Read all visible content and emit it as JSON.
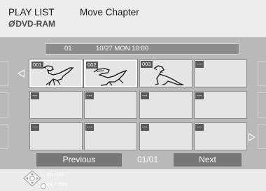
{
  "header": {
    "title": "PLAY LIST",
    "media": "DVD-RAM",
    "mode": "Move Chapter"
  },
  "info_bar": {
    "number": "01",
    "datetime": "10/27 MON 10:00"
  },
  "thumbnails": [
    {
      "label": "001",
      "content": "dinosaur-sketch-1",
      "selected": true
    },
    {
      "label": "002",
      "content": "dinosaur-sketch-2",
      "selected": true
    },
    {
      "label": "003",
      "content": "dinosaur-sketch-3",
      "selected": false
    },
    {
      "label": "---",
      "content": "empty",
      "selected": false
    },
    {
      "label": "---",
      "content": "empty",
      "selected": false
    },
    {
      "label": "---",
      "content": "empty",
      "selected": false
    },
    {
      "label": "---",
      "content": "empty",
      "selected": false
    },
    {
      "label": "---",
      "content": "empty",
      "selected": false
    },
    {
      "label": "---",
      "content": "empty",
      "selected": false
    },
    {
      "label": "---",
      "content": "empty",
      "selected": false
    },
    {
      "label": "---",
      "content": "empty",
      "selected": false
    },
    {
      "label": "---",
      "content": "empty",
      "selected": false
    }
  ],
  "nav": {
    "previous": "Previous",
    "page": "01/01",
    "next": "Next"
  },
  "footer": {
    "enter": "ENTER",
    "return": "RETURN"
  },
  "icons": {
    "left_arrow": "triangle-left-icon",
    "right_arrow": "triangle-right-icon",
    "dpad": "dpad-icon",
    "disc": "disc-icon"
  },
  "colors": {
    "panel": "#b9b9b9",
    "button": "#777777",
    "thumb": "#e5e5e5",
    "label_tag": "#5b5b5b"
  }
}
